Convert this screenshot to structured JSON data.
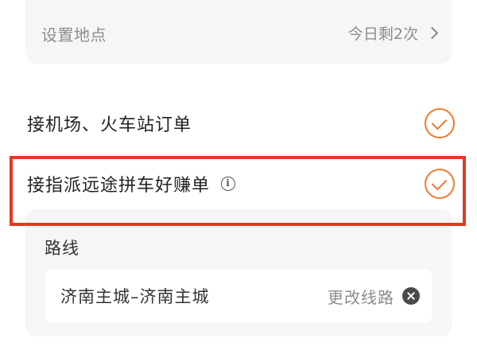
{
  "location": {
    "label": "设置地点",
    "remaining": "今日剩2次",
    "icon": "chevron-right-icon"
  },
  "options": [
    {
      "label": "接机场、火车站订单",
      "checked": true,
      "icon": "check-circle-icon"
    },
    {
      "label": "接指派远途拼车好赚单",
      "checked": true,
      "has_info": true,
      "info_glyph": "i",
      "icon": "check-circle-icon"
    }
  ],
  "route": {
    "title": "路线",
    "value": "济南主城–济南主城",
    "change_label": "更改线路",
    "remove_icon": "close-icon"
  },
  "colors": {
    "accent": "#ee7a2f",
    "highlight": "#e23a23",
    "card_bg": "#f6f6f7"
  }
}
